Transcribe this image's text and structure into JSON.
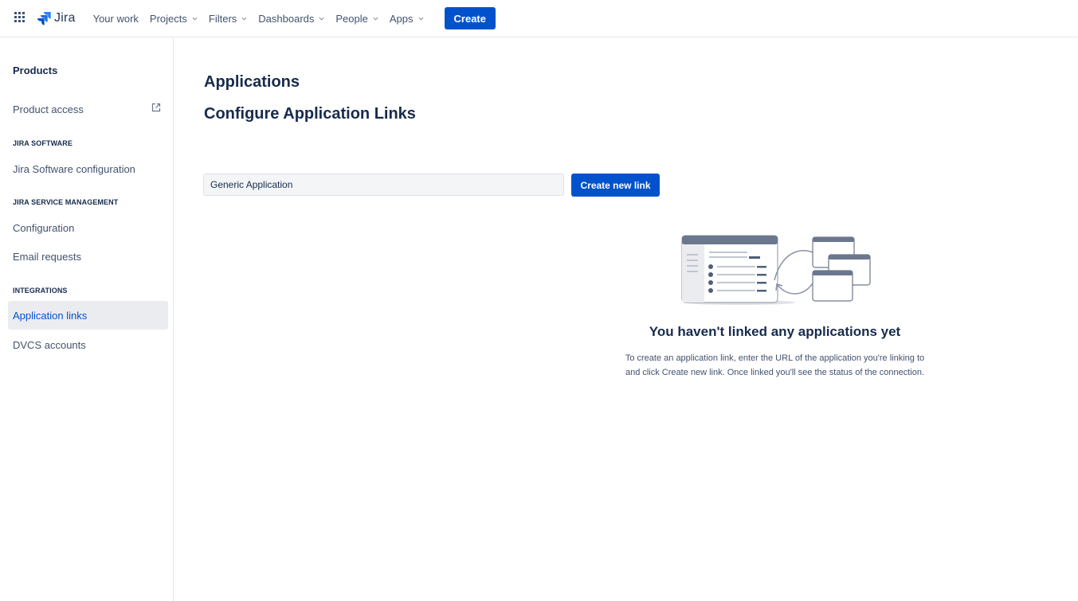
{
  "topnav": {
    "logo_text": "Jira",
    "items": [
      {
        "label": "Your work",
        "has_dropdown": false
      },
      {
        "label": "Projects",
        "has_dropdown": true
      },
      {
        "label": "Filters",
        "has_dropdown": true
      },
      {
        "label": "Dashboards",
        "has_dropdown": true
      },
      {
        "label": "People",
        "has_dropdown": true
      },
      {
        "label": "Apps",
        "has_dropdown": true
      }
    ],
    "create_label": "Create",
    "accent_color": "#0052cc"
  },
  "sidebar": {
    "products_title": "Products",
    "product_access": "Product access",
    "section_jira_software": "JIRA SOFTWARE",
    "jira_software_configuration": "Jira Software configuration",
    "section_service_management": "JIRA SERVICE MANAGEMENT",
    "configuration": "Configuration",
    "email_requests": "Email requests",
    "section_integrations": "INTEGRATIONS",
    "application_links": "Application links",
    "dvcs_accounts": "DVCS accounts",
    "active_item": "Application links"
  },
  "main": {
    "title": "Applications",
    "subtitle": "Configure Application Links",
    "input_value": "Generic Application",
    "create_link_label": "Create new link",
    "empty_heading": "You haven't linked any applications yet",
    "empty_body": "To create an application link, enter the URL of the application you're linking to and click Create new link. Once linked you'll see the status of the connection."
  }
}
